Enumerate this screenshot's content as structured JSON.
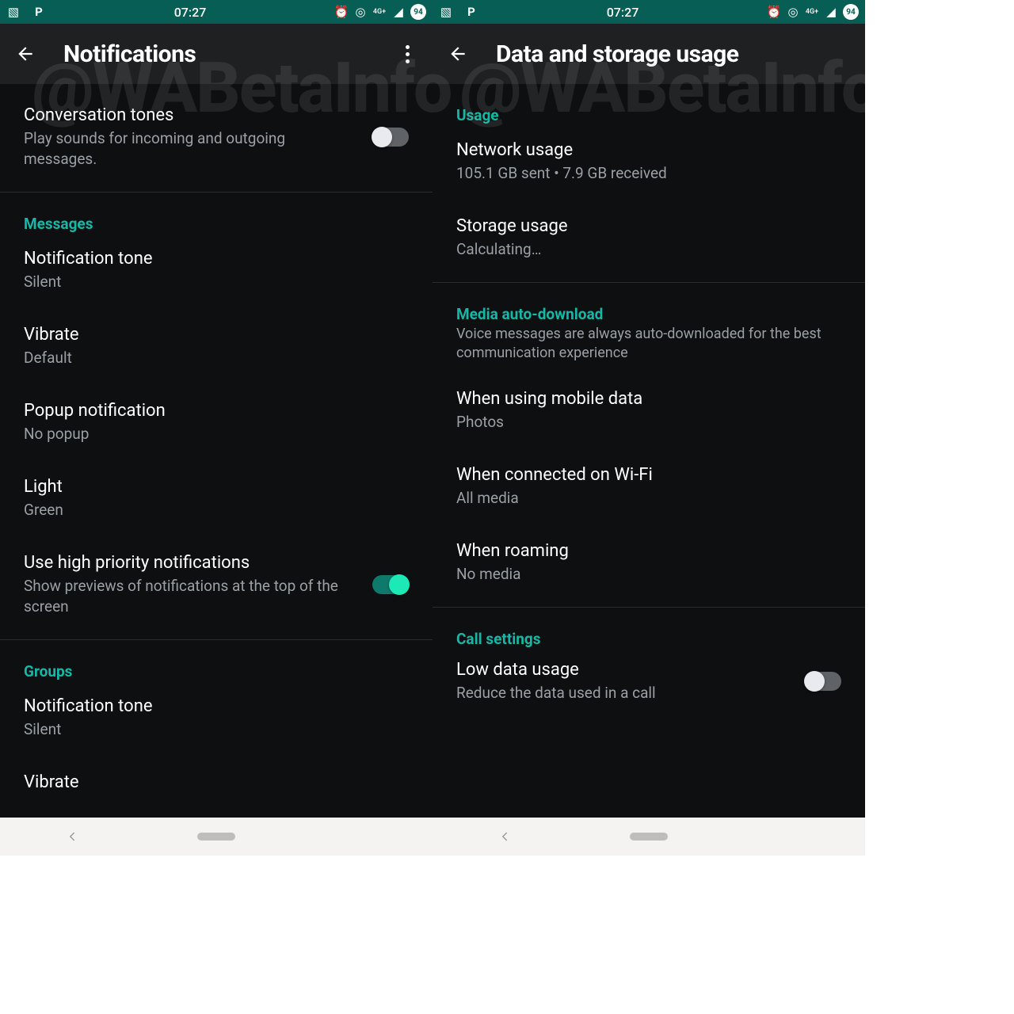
{
  "watermark": "@WABetaInfo",
  "status": {
    "time": "07:27",
    "badge": "94",
    "net": "4G+"
  },
  "left": {
    "title": "Notifications",
    "convo_tones": {
      "title": "Conversation tones",
      "sub": "Play sounds for incoming and outgoing messages."
    },
    "sec_messages": "Messages",
    "notif_tone": {
      "title": "Notification tone",
      "sub": "Silent"
    },
    "vibrate": {
      "title": "Vibrate",
      "sub": "Default"
    },
    "popup": {
      "title": "Popup notification",
      "sub": "No popup"
    },
    "light": {
      "title": "Light",
      "sub": "Green"
    },
    "high_pri": {
      "title": "Use high priority notifications",
      "sub": "Show previews of notifications at the top of the screen"
    },
    "sec_groups": "Groups",
    "g_notif_tone": {
      "title": "Notification tone",
      "sub": "Silent"
    },
    "g_vibrate": {
      "title": "Vibrate"
    }
  },
  "right": {
    "title": "Data and storage usage",
    "sec_usage": "Usage",
    "net_usage": {
      "title": "Network usage",
      "sub": "105.1 GB sent • 7.9 GB received"
    },
    "storage": {
      "title": "Storage usage",
      "sub": "Calculating…"
    },
    "sec_media": "Media auto-download",
    "media_desc": "Voice messages are always auto-downloaded for the best communication experience",
    "mobile": {
      "title": "When using mobile data",
      "sub": "Photos"
    },
    "wifi": {
      "title": "When connected on Wi-Fi",
      "sub": "All media"
    },
    "roaming": {
      "title": "When roaming",
      "sub": "No media"
    },
    "sec_calls": "Call settings",
    "low_data": {
      "title": "Low data usage",
      "sub": "Reduce the data used in a call"
    }
  }
}
